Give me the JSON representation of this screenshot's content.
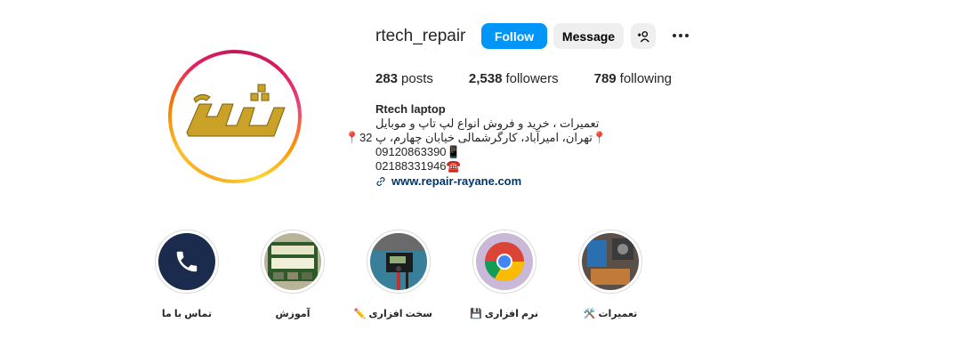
{
  "profile": {
    "username": "rtech_repair",
    "follow_label": "Follow",
    "message_label": "Message",
    "add_user_icon": "+👤"
  },
  "stats": {
    "posts_count": "283",
    "posts_label": "posts",
    "followers_count": "2,538",
    "followers_label": "followers",
    "following_count": "789",
    "following_label": "following"
  },
  "bio": {
    "name": "Rtech laptop",
    "line1": "تعمیرات ، خرید و فروش انواع لپ تاپ و موبایل",
    "line2": "📍تهران، امیرآباد، کارگرشمالی خیابان چهارم، پ 32📍",
    "line3": "📱09120863390",
    "line4": "☎️02188331946",
    "link": "www.repair-rayane.com"
  },
  "avatar": {
    "logo_text": "آرتک",
    "logo_color": "#c9a227"
  },
  "highlights": [
    {
      "label": "تماس با ما",
      "icon": "phone-icon"
    },
    {
      "label": "آموزش",
      "icon": "board-photo"
    },
    {
      "label": "سخت افزاری ✏️",
      "icon": "hardware-photo"
    },
    {
      "label": "نرم افزاری 💾",
      "icon": "software-photo"
    },
    {
      "label": "تعمیرات 🛠️",
      "icon": "repair-photo"
    }
  ],
  "colors": {
    "accent": "#0095f6",
    "link": "#00376b",
    "secondary_button": "#efefef"
  }
}
